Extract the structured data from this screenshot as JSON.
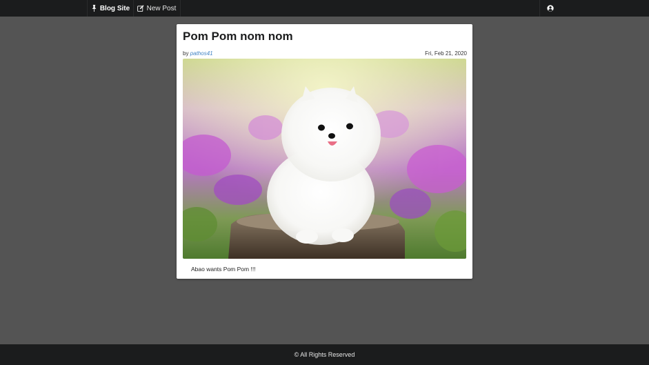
{
  "nav": {
    "brand_label": "Blog Site",
    "new_post_label": "New Post",
    "brand_icon": "pin-icon",
    "new_post_icon": "edit-icon",
    "user_icon": "user-circle-icon"
  },
  "post": {
    "title": "Pom Pom nom nom",
    "by_prefix": "by",
    "author": "pathos41",
    "date": "Fri, Feb 21, 2020",
    "body": "Abao wants Pom Pom !!!"
  },
  "footer": {
    "text": "© All Rights Reserved"
  },
  "colors": {
    "page_bg": "#545454",
    "bar_bg": "#1b1c1d",
    "link": "#4183c4"
  }
}
